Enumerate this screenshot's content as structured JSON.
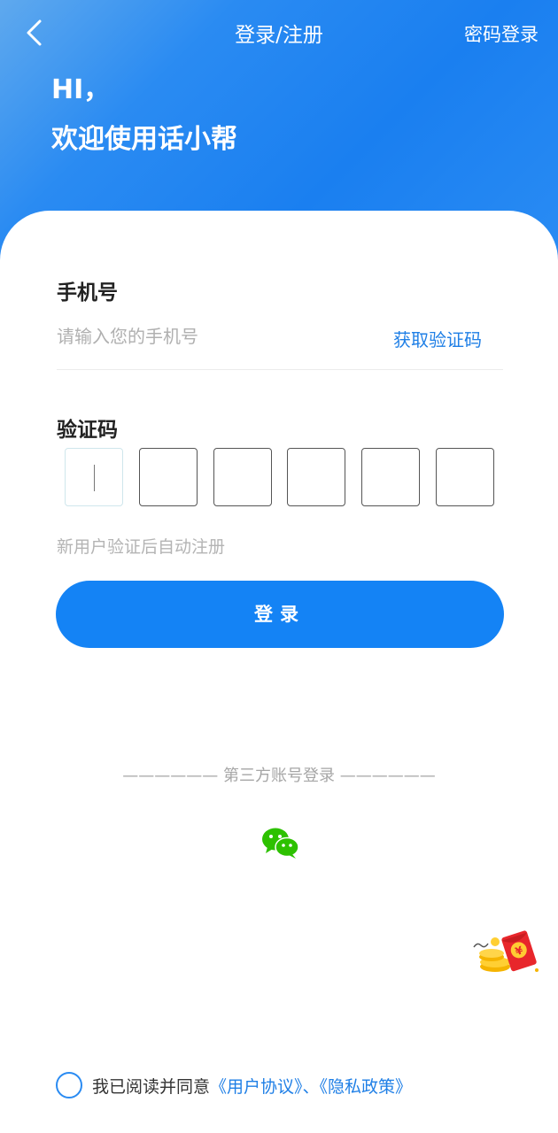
{
  "header": {
    "title": "登录/注册",
    "password_login": "密码登录",
    "greeting_line1": "HI，",
    "greeting_line2": "欢迎使用话小帮"
  },
  "form": {
    "phone_label": "手机号",
    "phone_placeholder": "请输入您的手机号",
    "get_code": "获取验证码",
    "code_label": "验证码",
    "code_length": 6,
    "hint": "新用户验证后自动注册",
    "login_button": "登录"
  },
  "third_party": {
    "title": "—————— 第三方账号登录 ——————",
    "icons": [
      "wechat-icon"
    ]
  },
  "agreement": {
    "prefix": "我已阅读并同意",
    "user_agreement": "《用户协议》",
    "separator": "、",
    "privacy_policy": "《隐私政策》"
  },
  "colors": {
    "primary": "#1483f5",
    "link": "#1f7fe6",
    "wechat": "#2dc100"
  }
}
